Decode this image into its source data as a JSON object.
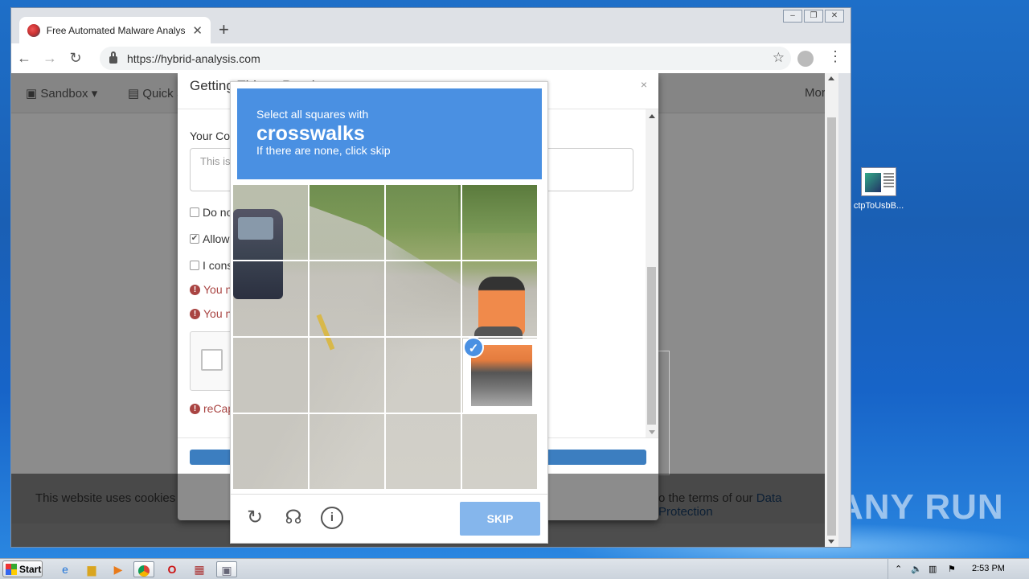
{
  "browser": {
    "tab_title": "Free Automated Malware Analysis S",
    "tab_close": "✕",
    "new_tab": "+",
    "url": "https://hybrid-analysis.com",
    "win_min": "–",
    "win_max": "❐",
    "win_close": "✕"
  },
  "site": {
    "nav_sandbox": "Sandbox",
    "nav_quick": "Quick S",
    "nav_more": "More"
  },
  "modal": {
    "title": "Getting Things Read",
    "close": "×",
    "comment_label": "Your Cor",
    "comment_placeholder": "This is",
    "checkbox_1": "Do no",
    "checkbox_2": "Allow",
    "checkbox_3": "I cons",
    "error_1": "You n",
    "error_2": "You n",
    "error_3": "reCap"
  },
  "captcha": {
    "instruction_line1": "Select all squares with",
    "instruction_target": "crosswalks",
    "instruction_line3": "If there are none, click skip",
    "skip_label": "SKIP"
  },
  "cookie_banner": {
    "text_left": "This website uses cookies to",
    "text_right": "o the terms of our ",
    "link": "Data Protection"
  },
  "desktop": {
    "icon_label": "ctpToUsbB...",
    "watermark": "ANY RUN"
  },
  "taskbar": {
    "start_label": "Start",
    "clock": "2:53 PM"
  }
}
